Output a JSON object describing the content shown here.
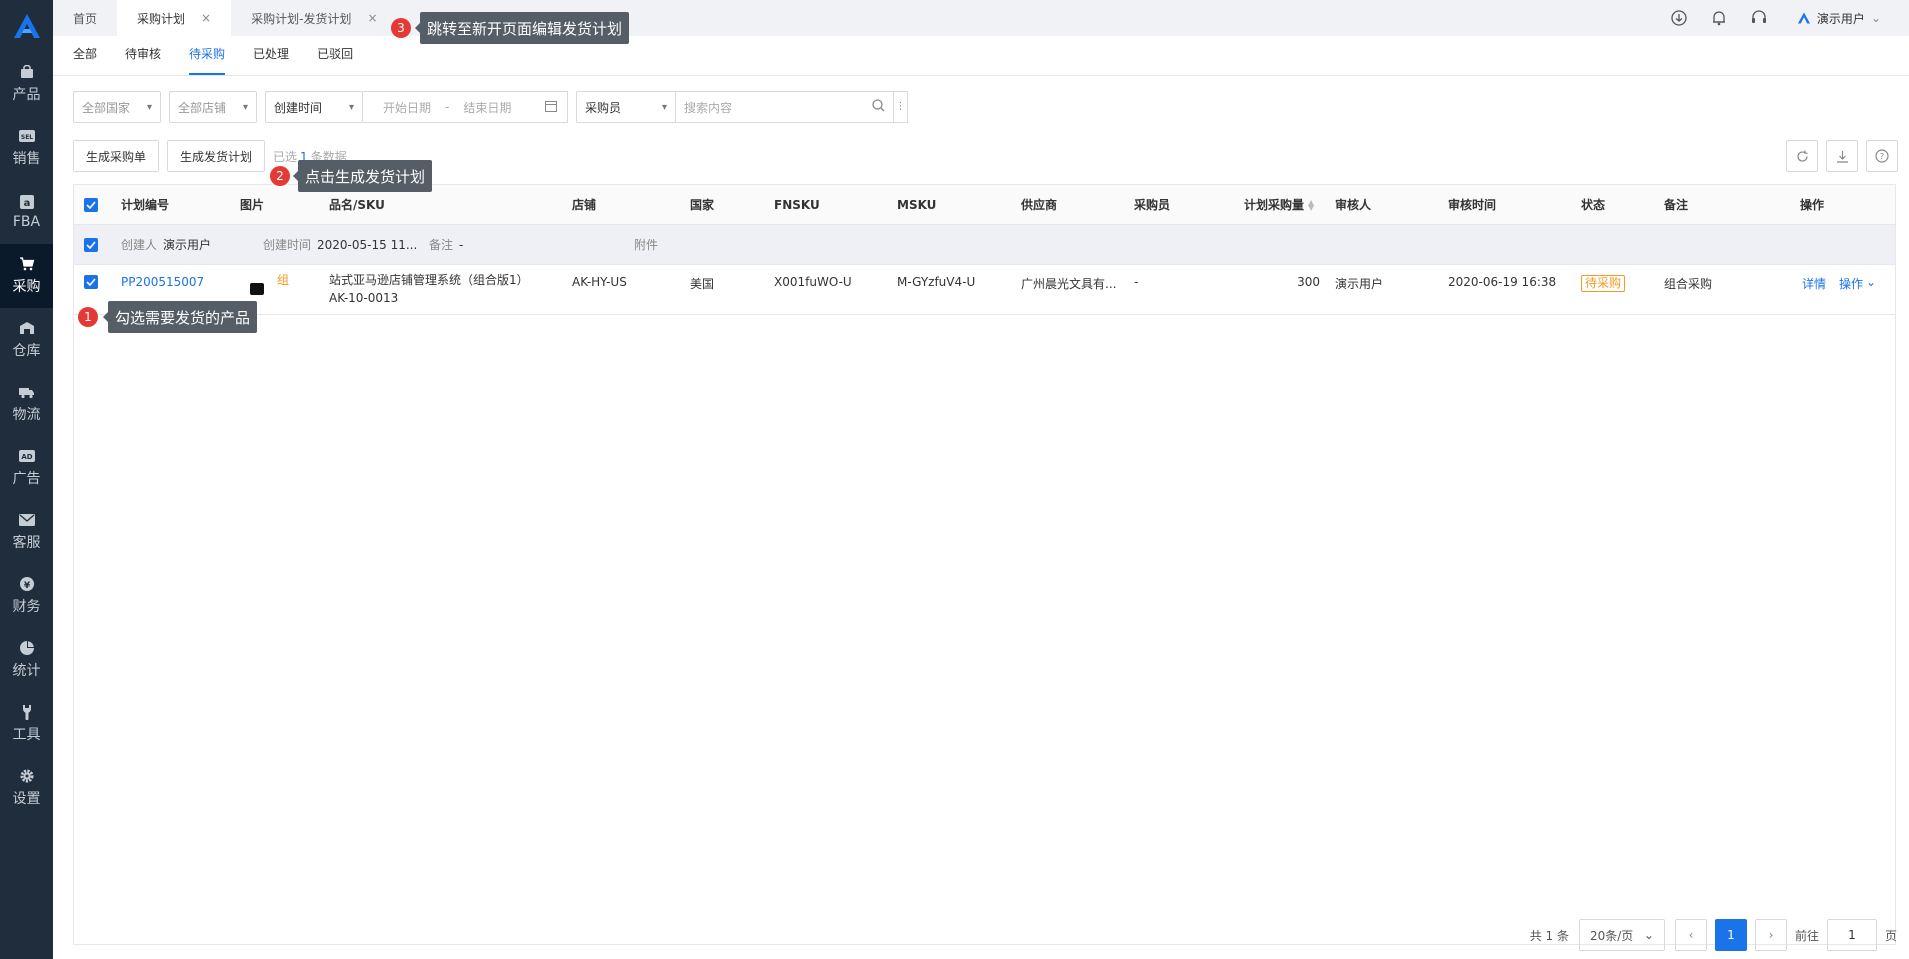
{
  "sidebar": {
    "items": [
      {
        "label": "产品",
        "icon": "bag-icon"
      },
      {
        "label": "销售",
        "icon": "sell-icon"
      },
      {
        "label": "FBA",
        "icon": "amazon-icon"
      },
      {
        "label": "采购",
        "icon": "cart-icon",
        "active": true
      },
      {
        "label": "仓库",
        "icon": "warehouse-icon"
      },
      {
        "label": "物流",
        "icon": "truck-icon"
      },
      {
        "label": "广告",
        "icon": "ad-icon"
      },
      {
        "label": "客服",
        "icon": "mail-icon"
      },
      {
        "label": "财务",
        "icon": "yen-icon"
      },
      {
        "label": "统计",
        "icon": "pie-icon"
      },
      {
        "label": "工具",
        "icon": "wrench-icon"
      },
      {
        "label": "设置",
        "icon": "gear-icon"
      }
    ]
  },
  "topbar": {
    "tabs": [
      {
        "label": "首页"
      },
      {
        "label": "采购计划",
        "close": "×"
      },
      {
        "label": "采购计划-发货计划",
        "close": "×"
      }
    ],
    "user": "演示用户"
  },
  "subtabs": [
    "全部",
    "待审核",
    "待采购",
    "已处理",
    "已驳回"
  ],
  "filters": {
    "country": "全部国家",
    "shop": "全部店铺",
    "time_type": "创建时间",
    "start_date": "开始日期",
    "dash": "-",
    "end_date": "结束日期",
    "buyer": "采购员",
    "search_placeholder": "搜索内容",
    "more": "⋮"
  },
  "actions": {
    "create_po": "生成采购单",
    "create_plan": "生成发货计划",
    "selected_prefix": "已选",
    "selected_count": "1",
    "selected_suffix": "条数据"
  },
  "table": {
    "headers": [
      "计划编号",
      "图片",
      "品名/SKU",
      "店铺",
      "国家",
      "FNSKU",
      "MSKU",
      "供应商",
      "采购员",
      "计划采购量",
      "审核人",
      "审核时间",
      "状态",
      "备注",
      "操作"
    ],
    "group": {
      "creator_label": "创建人",
      "creator": "演示用户",
      "created_label": "创建时间",
      "created": "2020-05-15 11...",
      "remark_label": "备注",
      "remark": "-",
      "attach_label": "附件"
    },
    "row": {
      "plan_no": "PP200515007",
      "group_tag": "组",
      "name": "站式亚马逊店铺管理系统（组合版1）",
      "sku": "AK-10-0013",
      "shop": "AK-HY-US",
      "country": "美国",
      "fnsku": "X001fuWO-U",
      "msku": "M-GYzfuV4-U",
      "supplier": "广州晨光文具有...",
      "buyer": "-",
      "qty": "300",
      "reviewer": "演示用户",
      "review_time": "2020-06-19 16:38",
      "status": "待采购",
      "note": "组合采购",
      "detail": "详情",
      "ops": "操作"
    }
  },
  "pager": {
    "total": "共 1 条",
    "size": "20条/页",
    "page": "1",
    "goto_label": "前往",
    "goto_value": "1",
    "page_unit": "页"
  },
  "tips": [
    {
      "num": "1",
      "text": "勾选需要发货的产品"
    },
    {
      "num": "2",
      "text": "点击生成发货计划"
    },
    {
      "num": "3",
      "text": "跳转至新开页面编辑发货计划"
    }
  ],
  "colors": {
    "accent": "#1a73e8",
    "warn": "#f59a23",
    "sidebar": "#1f2d3d",
    "badge": "#e53935"
  }
}
